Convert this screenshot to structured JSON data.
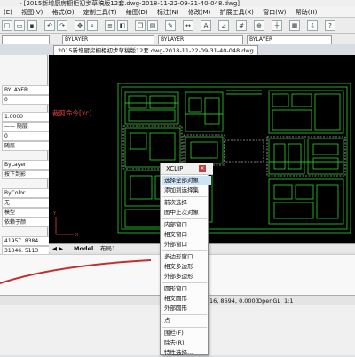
{
  "window": {
    "title": "- [2015新增厨房橱柜初步草稿版12套.dwg-2018-11-22-09-31-40-048.dwg]"
  },
  "menu": [
    "(E)",
    "视图(V)",
    "格式(O)",
    "定制工具(T)",
    "绘图(D)",
    "标注(N)",
    "修改(M)",
    "扩展工具(X)",
    "窗口(W)",
    "帮助(H)"
  ],
  "properties_bar": {
    "layer": "BYLAYER",
    "linetype": "BYLAYER",
    "lineweight": "BYLAYER"
  },
  "document_tab": "2015新增厨房橱柜初步草稿版12套.dwg-2018-11-22-09-31-40-048.dwg",
  "left_panel": {
    "rows": [
      "BYLAYER",
      "0",
      "1.0000",
      "—— 随层",
      "0",
      "随层",
      "ByLayer",
      "按下到影",
      "ByColor",
      "无",
      "模型",
      "依赖于颜",
      "41957. 8384",
      "31346. 5113"
    ]
  },
  "drawing": {
    "command_text": "裁剪命令[xc]",
    "color_text": "#e04040",
    "color_lines": "#33ee33"
  },
  "layout_tabs": [
    "Model",
    "布局1"
  ],
  "xclip": {
    "title": "XCLIP",
    "items": [
      "选择全部对象",
      "添加到选择集",
      "前次选择",
      "图中上次对象",
      "内部窗口",
      "相交窗口",
      "外部窗口",
      "多边形窗口",
      "相交多边形",
      "外部多边形",
      "圆形窗口",
      "相交圆形",
      "外部圆形",
      "点",
      "围栏(F)",
      "除去(R)",
      "特性选择..."
    ],
    "highlighted_index": 0
  },
  "status": {
    "coords": "16, 8694, 0.0000",
    "renderer": "OpenGL",
    "scale": "1:1"
  }
}
